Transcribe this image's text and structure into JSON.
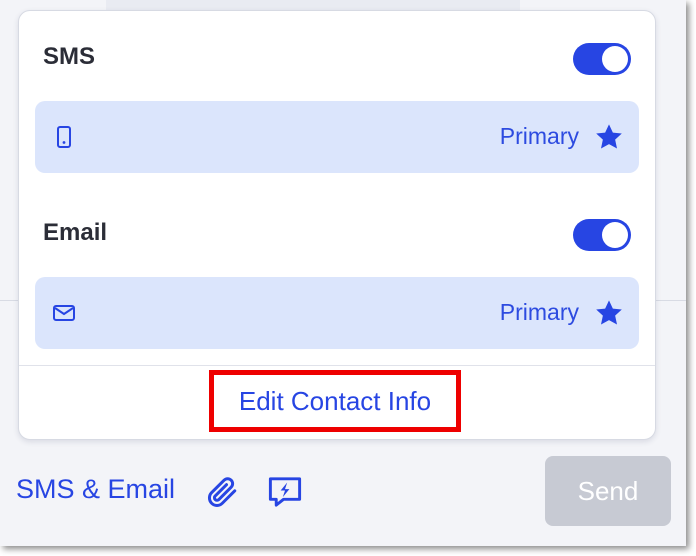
{
  "sms": {
    "title": "SMS",
    "toggle_on": true,
    "row": {
      "icon": "phone-icon",
      "badge": "Primary",
      "star_icon": "star-icon"
    }
  },
  "email": {
    "title": "Email",
    "toggle_on": true,
    "row": {
      "icon": "envelope-icon",
      "badge": "Primary",
      "star_icon": "star-icon"
    }
  },
  "edit_link": "Edit Contact Info",
  "composer": {
    "mode_label": "SMS & Email",
    "attach_icon": "paperclip-icon",
    "quick_reply_icon": "lightning-chat-icon",
    "send_label": "Send",
    "send_disabled": true
  },
  "colors": {
    "accent": "#2745e3",
    "row_bg": "#dbe5fc",
    "highlight_border": "#ee0000",
    "send_disabled_bg": "#c7cad3"
  }
}
